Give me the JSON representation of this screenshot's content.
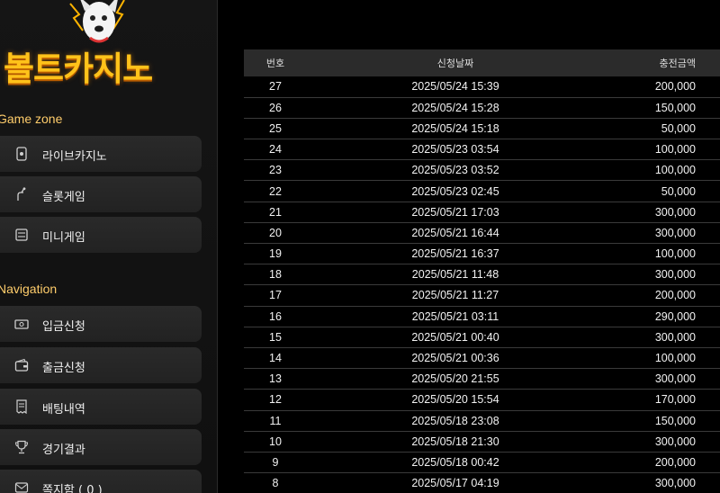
{
  "brand": {
    "logo_text": "볼트카지노"
  },
  "sections": {
    "game_zone": "Game zone",
    "navigation": "Navigation"
  },
  "game_menu": [
    {
      "label": "라이브카지노",
      "icon": "phone-card-icon"
    },
    {
      "label": "슬롯게임",
      "icon": "slot-lever-icon"
    },
    {
      "label": "미니게임",
      "icon": "tablet-icon"
    }
  ],
  "nav_menu": [
    {
      "label": "입금신청",
      "icon": "cash-icon"
    },
    {
      "label": "출금신청",
      "icon": "wallet-icon"
    },
    {
      "label": "배팅내역",
      "icon": "receipt-icon"
    },
    {
      "label": "경기결과",
      "icon": "trophy-icon"
    },
    {
      "label": "쪽지함 ( 0 )",
      "icon": "message-icon"
    }
  ],
  "table": {
    "headers": {
      "no": "번호",
      "date": "신청날짜",
      "amount": "충전금액"
    },
    "rows": [
      {
        "no": "27",
        "date": "2025/05/24 15:39",
        "amount": "200,000"
      },
      {
        "no": "26",
        "date": "2025/05/24 15:28",
        "amount": "150,000"
      },
      {
        "no": "25",
        "date": "2025/05/24 15:18",
        "amount": "50,000"
      },
      {
        "no": "24",
        "date": "2025/05/23 03:54",
        "amount": "100,000"
      },
      {
        "no": "23",
        "date": "2025/05/23 03:52",
        "amount": "100,000"
      },
      {
        "no": "22",
        "date": "2025/05/23 02:45",
        "amount": "50,000"
      },
      {
        "no": "21",
        "date": "2025/05/21 17:03",
        "amount": "300,000"
      },
      {
        "no": "20",
        "date": "2025/05/21 16:44",
        "amount": "300,000"
      },
      {
        "no": "19",
        "date": "2025/05/21 16:37",
        "amount": "100,000"
      },
      {
        "no": "18",
        "date": "2025/05/21 11:48",
        "amount": "300,000"
      },
      {
        "no": "17",
        "date": "2025/05/21 11:27",
        "amount": "200,000"
      },
      {
        "no": "16",
        "date": "2025/05/21 03:11",
        "amount": "290,000"
      },
      {
        "no": "15",
        "date": "2025/05/21 00:40",
        "amount": "300,000"
      },
      {
        "no": "14",
        "date": "2025/05/21 00:36",
        "amount": "100,000"
      },
      {
        "no": "13",
        "date": "2025/05/20 21:55",
        "amount": "300,000"
      },
      {
        "no": "12",
        "date": "2025/05/20 15:54",
        "amount": "170,000"
      },
      {
        "no": "11",
        "date": "2025/05/18 23:08",
        "amount": "150,000"
      },
      {
        "no": "10",
        "date": "2025/05/18 21:30",
        "amount": "300,000"
      },
      {
        "no": "9",
        "date": "2025/05/18 00:42",
        "amount": "200,000"
      },
      {
        "no": "8",
        "date": "2025/05/17 04:19",
        "amount": "300,000"
      }
    ]
  },
  "colors": {
    "accent": "#ffc21a",
    "section_label": "#ffcd6b",
    "background": "#000000",
    "menu_bg": "#262626"
  }
}
